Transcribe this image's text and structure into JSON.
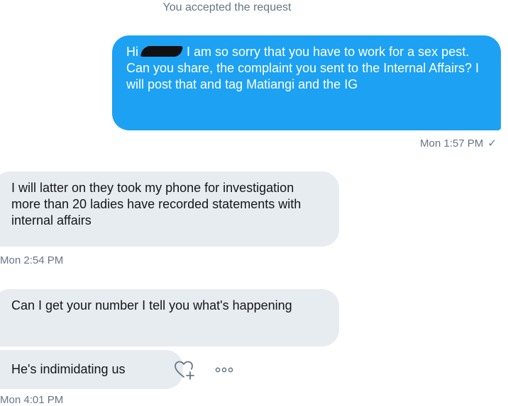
{
  "system_note": "You accepted the request",
  "messages": {
    "outgoing_1": {
      "greeting": "Hi",
      "text": "I am so sorry that you have to work for a sex pest. Can you share, the complaint you sent to the Internal Affairs? I will post that and tag Matiangi and the IG",
      "time": "Mon 1:57 PM",
      "status_icon": "checkmark-icon"
    },
    "incoming_1": {
      "text": "I will latter on they took my phone for investigation more than 20 ladies have recorded statements with internal affairs",
      "time": "Mon 2:54 PM"
    },
    "incoming_2": {
      "text": "Can I get your number I tell you what's happening"
    },
    "incoming_3": {
      "text": "He's indimidating us",
      "time": "Mon 4:01 PM"
    }
  },
  "actions": {
    "react_icon": "heart-plus-icon",
    "more_icon": "more-options-icon"
  },
  "colors": {
    "outgoing_bubble": "#1da1f2",
    "incoming_bubble": "#e6ecf0",
    "meta_text": "#657786"
  }
}
